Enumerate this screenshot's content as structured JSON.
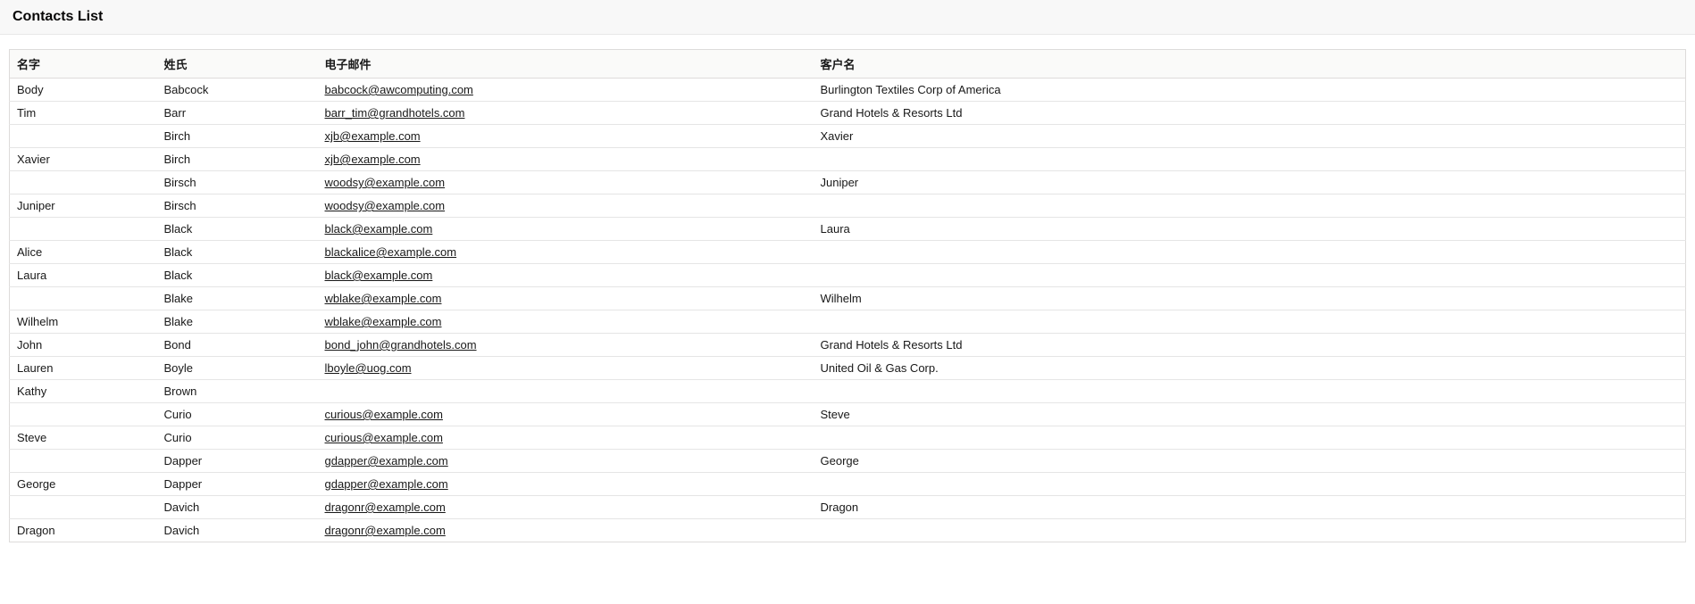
{
  "header": {
    "title": "Contacts List"
  },
  "table": {
    "columns": [
      {
        "key": "first",
        "label": "名字"
      },
      {
        "key": "last",
        "label": "姓氏"
      },
      {
        "key": "email",
        "label": "电子邮件"
      },
      {
        "key": "account",
        "label": "客户名"
      }
    ],
    "rows": [
      {
        "first": "Body",
        "last": "Babcock",
        "email": "babcock@awcomputing.com",
        "account": "Burlington Textiles Corp of America"
      },
      {
        "first": "Tim",
        "last": "Barr",
        "email": "barr_tim@grandhotels.com",
        "account": "Grand Hotels & Resorts Ltd"
      },
      {
        "first": "",
        "last": "Birch",
        "email": "xjb@example.com",
        "account": "Xavier"
      },
      {
        "first": "Xavier",
        "last": "Birch",
        "email": "xjb@example.com",
        "account": ""
      },
      {
        "first": "",
        "last": "Birsch",
        "email": "woodsy@example.com",
        "account": "Juniper"
      },
      {
        "first": "Juniper",
        "last": "Birsch",
        "email": "woodsy@example.com",
        "account": ""
      },
      {
        "first": "",
        "last": "Black",
        "email": "black@example.com",
        "account": "Laura"
      },
      {
        "first": "Alice",
        "last": "Black",
        "email": "blackalice@example.com",
        "account": ""
      },
      {
        "first": "Laura",
        "last": "Black",
        "email": "black@example.com",
        "account": ""
      },
      {
        "first": "",
        "last": "Blake",
        "email": "wblake@example.com",
        "account": "Wilhelm"
      },
      {
        "first": "Wilhelm",
        "last": "Blake",
        "email": "wblake@example.com",
        "account": ""
      },
      {
        "first": "John",
        "last": "Bond",
        "email": "bond_john@grandhotels.com",
        "account": "Grand Hotels & Resorts Ltd"
      },
      {
        "first": "Lauren",
        "last": "Boyle",
        "email": "lboyle@uog.com",
        "account": "United Oil & Gas Corp."
      },
      {
        "first": "Kathy",
        "last": "Brown",
        "email": "",
        "account": ""
      },
      {
        "first": "",
        "last": "Curio",
        "email": "curious@example.com",
        "account": "Steve"
      },
      {
        "first": "Steve",
        "last": "Curio",
        "email": "curious@example.com",
        "account": ""
      },
      {
        "first": "",
        "last": "Dapper",
        "email": "gdapper@example.com",
        "account": "George"
      },
      {
        "first": "George",
        "last": "Dapper",
        "email": "gdapper@example.com",
        "account": ""
      },
      {
        "first": "",
        "last": "Davich",
        "email": "dragonr@example.com",
        "account": "Dragon"
      },
      {
        "first": "Dragon",
        "last": "Davich",
        "email": "dragonr@example.com",
        "account": ""
      }
    ]
  }
}
